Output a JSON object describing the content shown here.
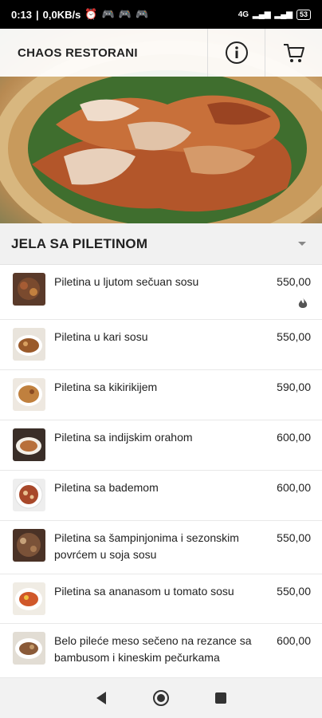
{
  "status": {
    "time": "0:13",
    "net": "0,0KB/s",
    "signal": "4G",
    "battery": "53"
  },
  "header": {
    "title": "CHAOS RESTORANI",
    "info_icon": "info-icon",
    "cart_icon": "cart-icon"
  },
  "category": {
    "title": "JELA SA PILETINOM"
  },
  "items": [
    {
      "name": "Piletina u ljutom sečuan sosu",
      "price": "550,00",
      "spicy": true
    },
    {
      "name": "Piletina u kari sosu",
      "price": "550,00"
    },
    {
      "name": "Piletina sa kikirikijem",
      "price": "590,00"
    },
    {
      "name": "Piletina sa indijskim orahom",
      "price": "600,00"
    },
    {
      "name": "Piletina sa bademom",
      "price": "600,00"
    },
    {
      "name": "Piletina sa šampinjonima i sezonskim povrćem u soja sosu",
      "price": "550,00"
    },
    {
      "name": "Piletina sa ananasom u tomato sosu",
      "price": "550,00"
    },
    {
      "name": "Belo pileće meso sečeno na rezance sa bambusom i kineskim pečurkama",
      "price": "600,00"
    }
  ],
  "colors": {
    "header_bg": "#ffffff",
    "text": "#222222",
    "category_bg": "#f1f1f1"
  }
}
